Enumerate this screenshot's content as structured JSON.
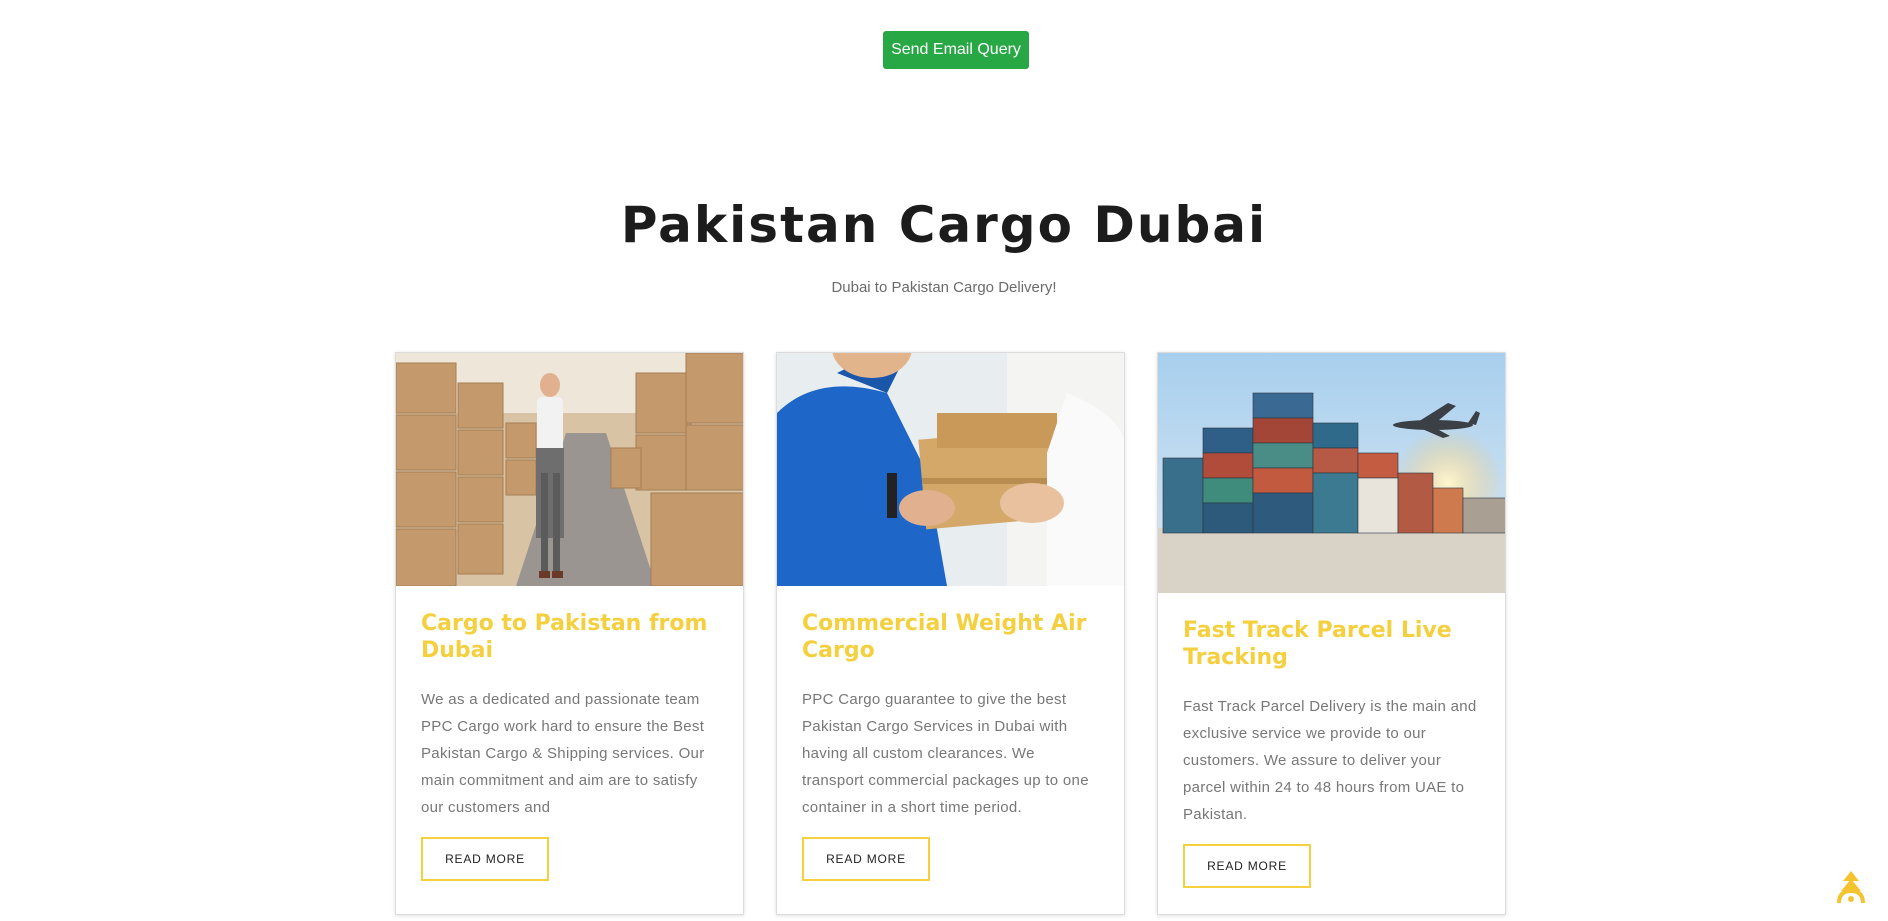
{
  "email_query": {
    "label": "Send Email Query",
    "color": "#28a745"
  },
  "section": {
    "title": "Pakistan Cargo Dubai",
    "subtitle": "Dubai to Pakistan Cargo Delivery!"
  },
  "accent_color": "#f4d03f",
  "cards": [
    {
      "title": "Cargo to Pakistan from Dubai",
      "text": "We as a dedicated and passionate team PPC Cargo work hard to ensure the Best Pakistan Cargo & Shipping services. Our main commitment and aim are to satisfy our customers and",
      "button": "READ MORE",
      "image": "warehouse-worker-photo"
    },
    {
      "title": "Commercial Weight Air Cargo",
      "text": "PPC Cargo guarantee to give the best Pakistan Cargo Services in Dubai with having all custom clearances. We transport commercial packages up to one container in a short time period.",
      "button": "READ MORE",
      "image": "parcel-handover-photo"
    },
    {
      "title": "Fast Track Parcel Live Tracking",
      "text": "Fast Track Parcel Delivery is the main and exclusive service we provide to our customers. We assure to deliver your parcel within 24 to 48 hours from UAE to Pakistan.",
      "button": "READ MORE",
      "image": "container-port-airplane-photo"
    }
  ],
  "scroll_top": {
    "icon": "arrow-up-icon"
  }
}
